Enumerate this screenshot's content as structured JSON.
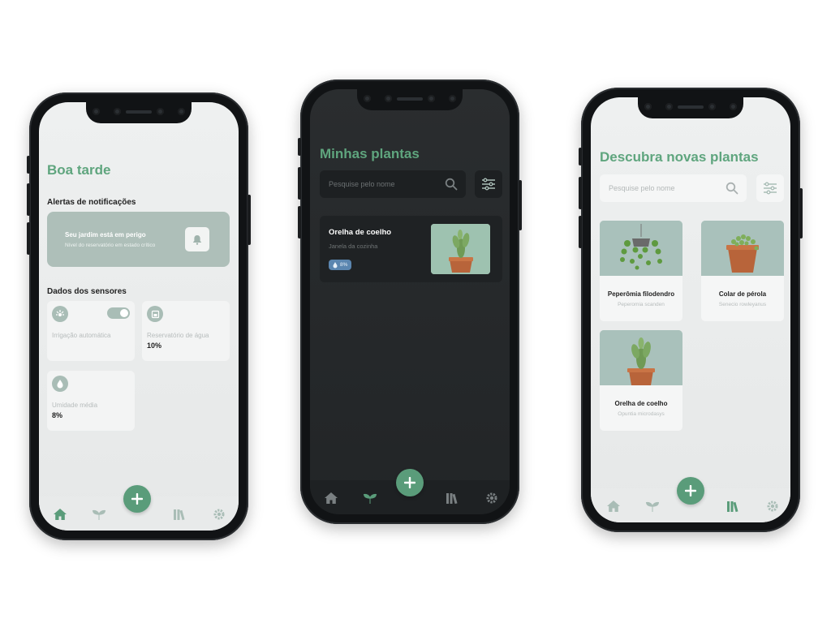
{
  "screens": {
    "home": {
      "greeting": "Boa tarde",
      "alerts_title": "Alertas de notificações",
      "alert": {
        "title": "Seu jardim está em perigo",
        "subtitle": "Nível do reservatório em estado crítico"
      },
      "sensors_title": "Dados dos sensores",
      "sensors": [
        {
          "label": "Irrigação automática",
          "value": "",
          "icon": "sprinkler-icon",
          "toggle_on": true
        },
        {
          "label": "Reservatório de água",
          "value": "10%",
          "icon": "reservoir-icon"
        },
        {
          "label": "Umidade média",
          "value": "8%",
          "icon": "humidity-icon"
        }
      ]
    },
    "my_plants": {
      "title": "Minhas plantas",
      "search_placeholder": "Pesquise pelo nome",
      "plants": [
        {
          "name": "Orelha de coelho",
          "location": "Janela da cozinha",
          "moisture": "8%"
        }
      ]
    },
    "discover": {
      "title": "Descubra novas plantas",
      "search_placeholder": "Pesquise pelo nome",
      "plants": [
        {
          "name": "Peperômia filodendro",
          "scientific": "Peperomia scanden"
        },
        {
          "name": "Colar de pérola",
          "scientific": "Senecio rowleyanus"
        },
        {
          "name": "Orelha de coelho",
          "scientific": "Opuntia microdasys"
        }
      ]
    }
  },
  "nav": {
    "items": [
      "home-icon",
      "plant-icon",
      "add-icon",
      "library-icon",
      "settings-icon"
    ],
    "fab_label": "+"
  },
  "colors": {
    "accent": "#5fa57e",
    "fab": "#5a9c7a",
    "alert_card": "#aebfb9",
    "moisture_badge": "#5b86b0"
  }
}
